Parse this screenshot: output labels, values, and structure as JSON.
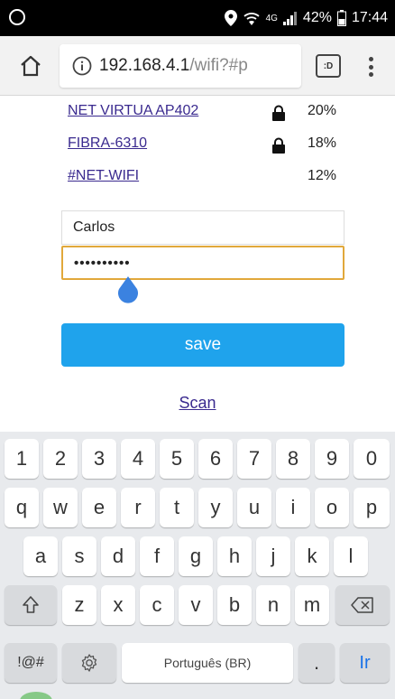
{
  "status_bar": {
    "battery": "42%",
    "time": "17:44",
    "network_type": "4G"
  },
  "browser": {
    "url_host": "192.168.4.1",
    "url_path": "/wifi?#p",
    "tabs_label": ":D"
  },
  "networks": [
    {
      "ssid": "NET VIRTUA AP402",
      "locked": true,
      "signal": "20%"
    },
    {
      "ssid": "FIBRA-6310",
      "locked": true,
      "signal": "18%"
    },
    {
      "ssid": "#NET-WIFI",
      "locked": false,
      "signal": "12%"
    }
  ],
  "form": {
    "ssid_value": "Carlos",
    "password_value": "••••••••••",
    "save_label": "save",
    "scan_label": "Scan"
  },
  "keyboard": {
    "row_numbers": [
      "1",
      "2",
      "3",
      "4",
      "5",
      "6",
      "7",
      "8",
      "9",
      "0"
    ],
    "row_1": [
      "q",
      "w",
      "e",
      "r",
      "t",
      "y",
      "u",
      "i",
      "o",
      "p"
    ],
    "row_2": [
      "a",
      "s",
      "d",
      "f",
      "g",
      "h",
      "j",
      "k",
      "l"
    ],
    "row_3": [
      "z",
      "x",
      "c",
      "v",
      "b",
      "n",
      "m"
    ],
    "symbols_label": "!@#",
    "space_label": "Português (BR)",
    "period_label": ".",
    "go_label": "Ir"
  },
  "colors": {
    "link": "#3a2a8f",
    "button": "#1fa3ec",
    "focus_border": "#e1a83b",
    "keyboard_bg": "#e8eaed"
  }
}
